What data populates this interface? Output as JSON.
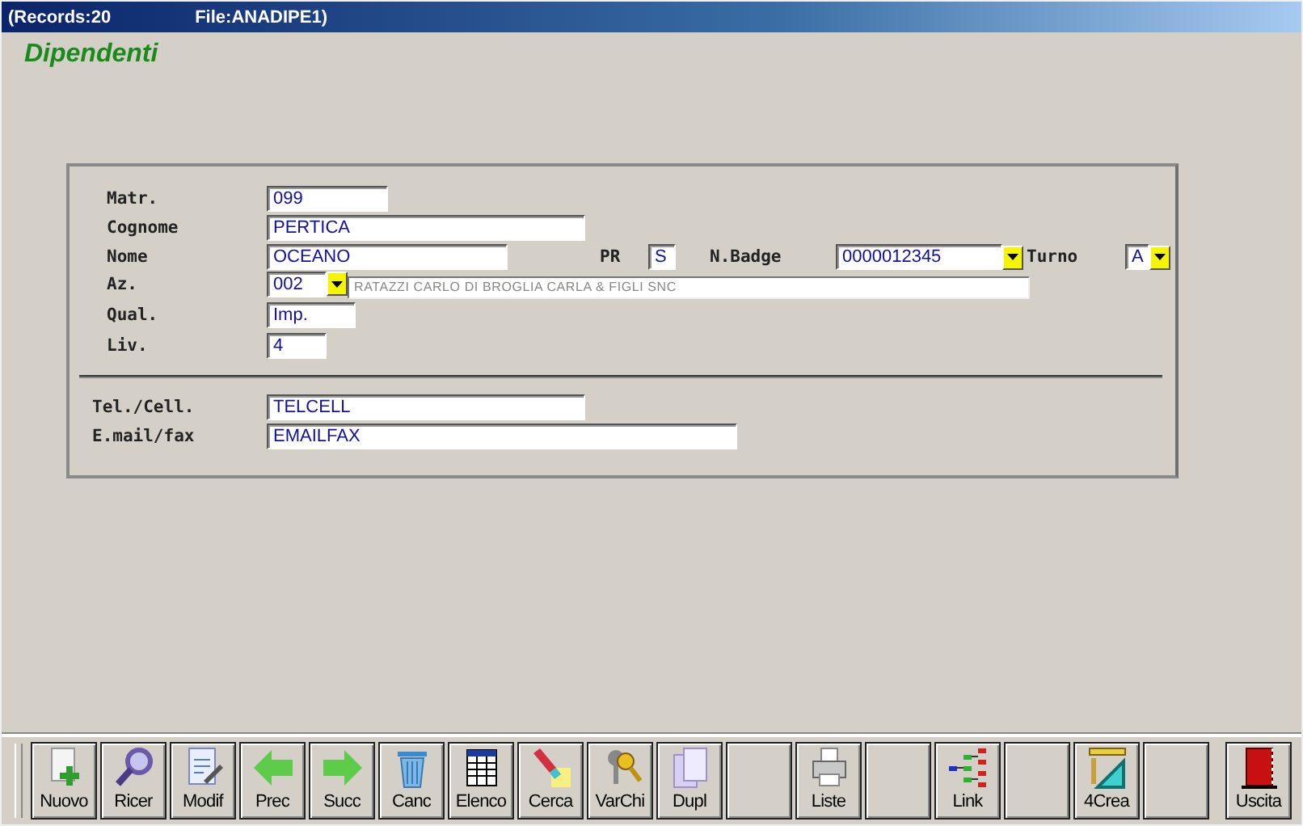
{
  "title_bar": {
    "records": "(Records:20",
    "file": "File:ANADIPE1)"
  },
  "heading": "Dipendenti",
  "form": {
    "matr": {
      "label": "Matr.",
      "value": "099"
    },
    "cognome": {
      "label": "Cognome",
      "value": "PERTICA"
    },
    "nome": {
      "label": "Nome",
      "value": "OCEANO"
    },
    "pr": {
      "label": "PR",
      "value": "S"
    },
    "badge": {
      "label": "N.Badge",
      "value": "0000012345"
    },
    "turno": {
      "label": "Turno",
      "value": "A"
    },
    "az": {
      "label": "Az.",
      "value": "002",
      "description": "RATAZZI CARLO DI BROGLIA CARLA & FIGLI SNC"
    },
    "qual": {
      "label": "Qual.",
      "value": "Imp."
    },
    "liv": {
      "label": "Liv.",
      "value": "4"
    },
    "tel": {
      "label": "Tel./Cell.",
      "value": "TELCELL"
    },
    "email": {
      "label": "E.mail/fax",
      "value": "EMAILFAX"
    }
  },
  "toolbar": [
    {
      "kind": "action",
      "label": "Nuovo"
    },
    {
      "kind": "action",
      "label": "Ricer"
    },
    {
      "kind": "action",
      "label": "Modif"
    },
    {
      "kind": "action",
      "label": "Prec"
    },
    {
      "kind": "action",
      "label": "Succ"
    },
    {
      "kind": "action",
      "label": "Canc"
    },
    {
      "kind": "action",
      "label": "Elenco"
    },
    {
      "kind": "action",
      "label": "Cerca"
    },
    {
      "kind": "action",
      "label": "VarChi"
    },
    {
      "kind": "action",
      "label": "Dupl"
    },
    {
      "kind": "blank"
    },
    {
      "kind": "action",
      "label": "Liste"
    },
    {
      "kind": "blank"
    },
    {
      "kind": "action",
      "label": "Link"
    },
    {
      "kind": "blank"
    },
    {
      "kind": "action",
      "label": "4Crea"
    },
    {
      "kind": "blank"
    },
    {
      "kind": "exit",
      "label": "Uscita"
    }
  ]
}
